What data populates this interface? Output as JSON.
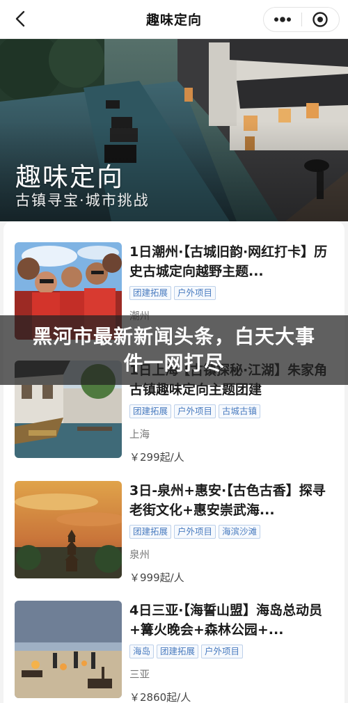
{
  "nav": {
    "title": "趣味定向",
    "back_icon": "chevron-left-icon",
    "more_icon": "more-dots-icon",
    "target_icon": "target-icon"
  },
  "hero": {
    "title": "趣味定向",
    "subtitle": "古镇寻宝·城市挑战"
  },
  "overlay": {
    "headline": "黑河市最新新闻头条，白天大事件一网打尽"
  },
  "items": [
    {
      "title": "1日潮州·【古城旧韵·网红打卡】历史古城定向越野主题...",
      "tags": [
        "团建拓展",
        "户外项目"
      ],
      "city": "潮州",
      "price": ""
    },
    {
      "title": "1日上海·【古镇探秘·江湖】朱家角古镇趣味定向主题团建",
      "tags": [
        "团建拓展",
        "户外项目",
        "古城古镇"
      ],
      "city": "上海",
      "price": "￥299起/人"
    },
    {
      "title": "3日-泉州+惠安·【古色古香】探寻老街文化+惠安崇武海...",
      "tags": [
        "团建拓展",
        "户外项目",
        "海滨沙滩"
      ],
      "city": "泉州",
      "price": "￥999起/人"
    },
    {
      "title": "4日三亚·【海誓山盟】海岛总动员+篝火晚会+森林公园+...",
      "tags": [
        "海岛",
        "团建拓展",
        "户外项目"
      ],
      "city": "三亚",
      "price": "￥2860起/人"
    }
  ]
}
